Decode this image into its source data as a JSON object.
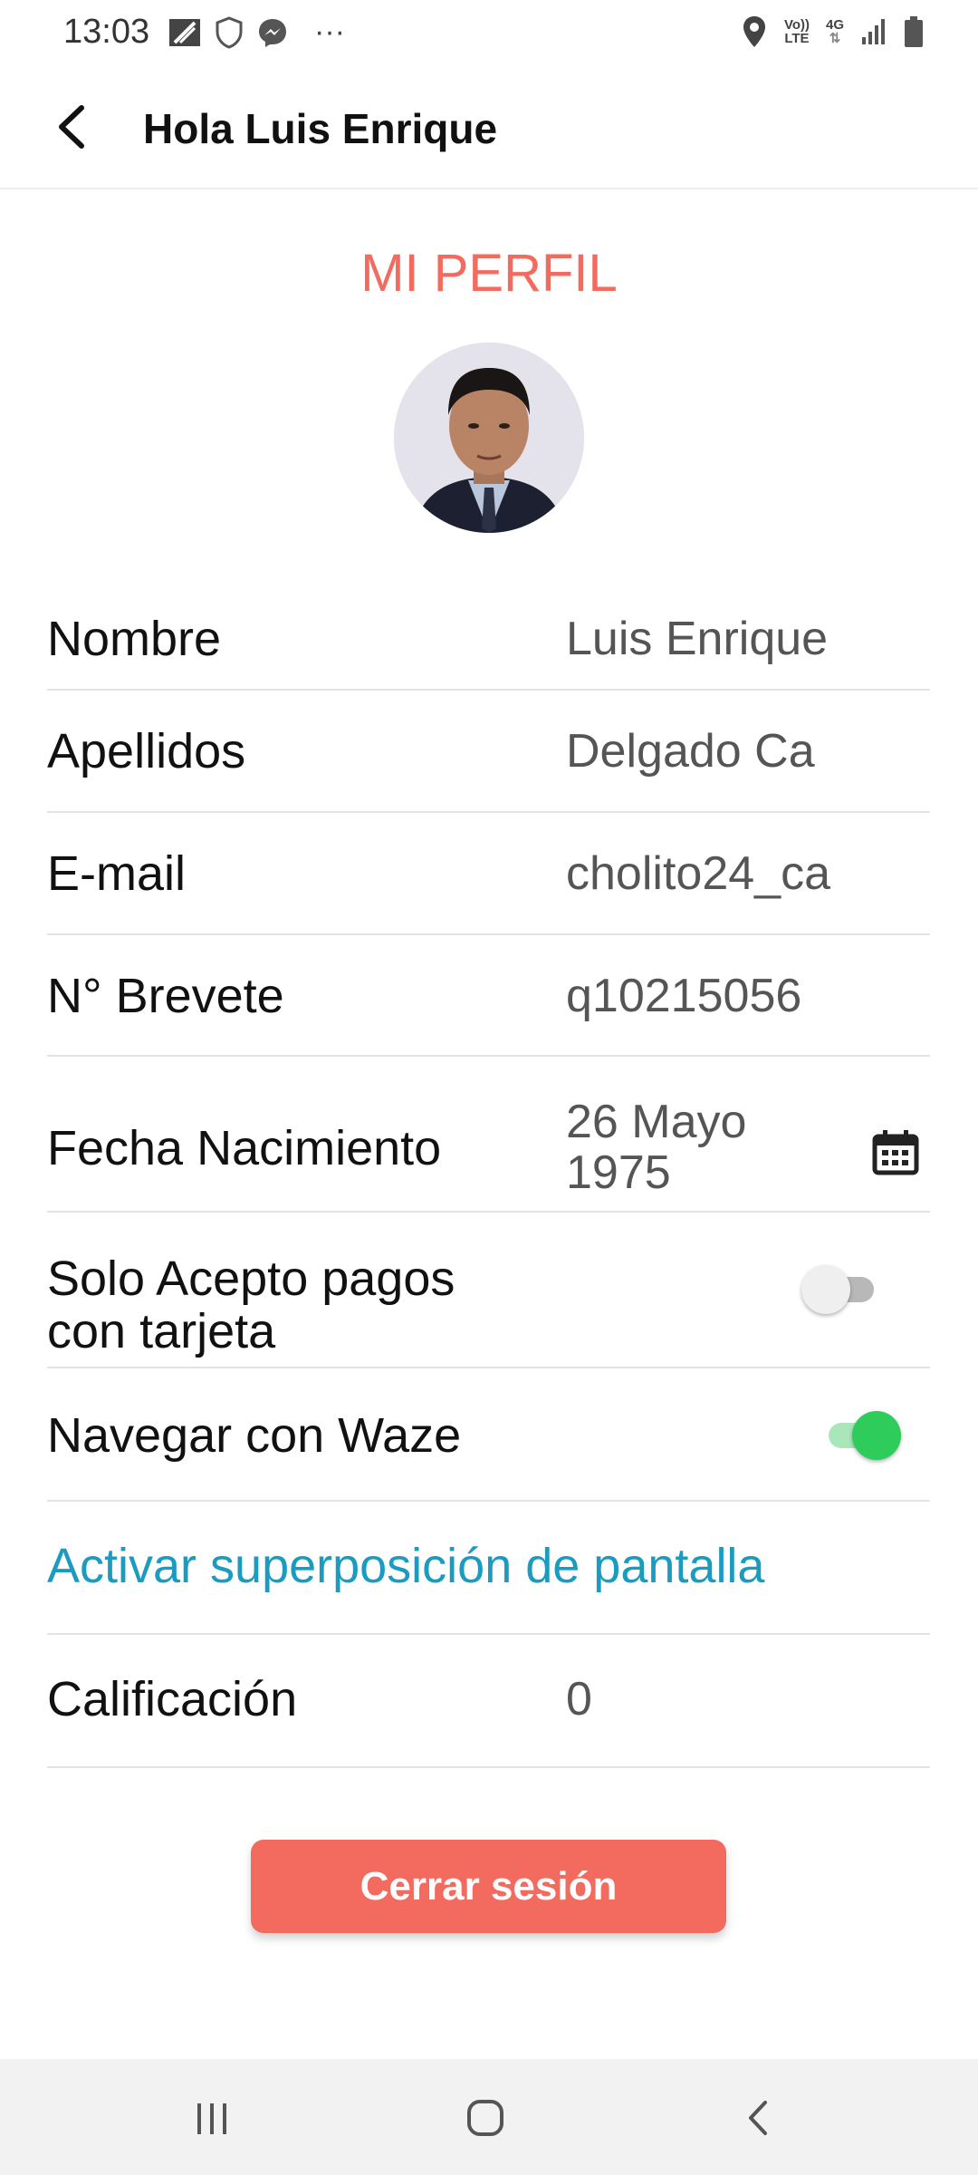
{
  "status_bar": {
    "time": "13:03",
    "overflow": "···",
    "volte": "Vo))",
    "lte": "LTE",
    "network": "4G",
    "icons_left": [
      "nfc-icon",
      "shield-icon",
      "messenger-icon"
    ],
    "icons_right": [
      "location-icon",
      "signal-icon",
      "battery-icon"
    ]
  },
  "app_bar": {
    "title": "Hola Luis Enrique",
    "back_icon": "arrow-back-icon"
  },
  "profile": {
    "title": "MI PERFIL",
    "avatar": "profile-photo"
  },
  "fields": {
    "nombre": {
      "label": "Nombre",
      "value": "Luis Enrique"
    },
    "apellidos": {
      "label": "Apellidos",
      "value": "Delgado Ca"
    },
    "email": {
      "label": "E-mail",
      "value": "cholito24_ca"
    },
    "brevete": {
      "label": "N° Brevete",
      "value": "q10215056"
    },
    "fecha": {
      "label": "Fecha Nacimiento",
      "value_line1": "26 Mayo",
      "value_line2": "1975",
      "icon": "calendar-icon"
    },
    "tarjeta": {
      "label_line1": "Solo Acepto pagos",
      "label_line2": "con tarjeta",
      "enabled": false
    },
    "waze": {
      "label": "Navegar con Waze",
      "enabled": true
    },
    "superposicion": {
      "label": "Activar superposición de pantalla"
    },
    "calificacion": {
      "label": "Calificación",
      "value": "0"
    }
  },
  "actions": {
    "logout": "Cerrar sesión"
  },
  "nav": {
    "recents": "recents-icon",
    "home": "home-icon",
    "back": "back-icon"
  },
  "colors": {
    "accent": "#f26b5e",
    "link": "#1a9bbf",
    "toggle_on": "#2ecc5a",
    "toggle_off": "#e0e0e0"
  }
}
